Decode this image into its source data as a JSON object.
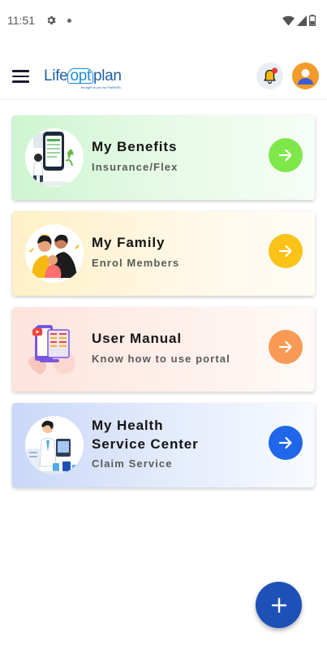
{
  "status_bar": {
    "time": "11:51",
    "icons": [
      "gear-icon",
      "notification-dot-icon",
      "wifi-icon",
      "signal-icon",
      "battery-icon"
    ]
  },
  "app_bar": {
    "logo_prefix": "Life",
    "logo_opt": "opt",
    "logo_suffix": "plan",
    "logo_tagline": "brought to you by FAIRASIL",
    "icons": [
      "menu-icon",
      "bell-icon",
      "avatar-icon"
    ]
  },
  "cards": [
    {
      "title": "My Benefits",
      "subtitle": "Insurance/Flex",
      "arrow_color": "#7ee84a",
      "icon": "phone-benefits-illustration"
    },
    {
      "title": "My Family",
      "subtitle": "Enrol Members",
      "arrow_color": "#fbc217",
      "icon": "family-illustration"
    },
    {
      "title": "User Manual",
      "subtitle": "Know how to use portal",
      "arrow_color": "#f89a55",
      "icon": "manual-illustration"
    },
    {
      "title_line1": "My Health",
      "title_line2": "Service Center",
      "subtitle": "Claim Service",
      "arrow_color": "#1f66e8",
      "icon": "doctor-illustration"
    }
  ],
  "fab": {
    "icon": "plus-icon",
    "color": "#1d51b8"
  }
}
